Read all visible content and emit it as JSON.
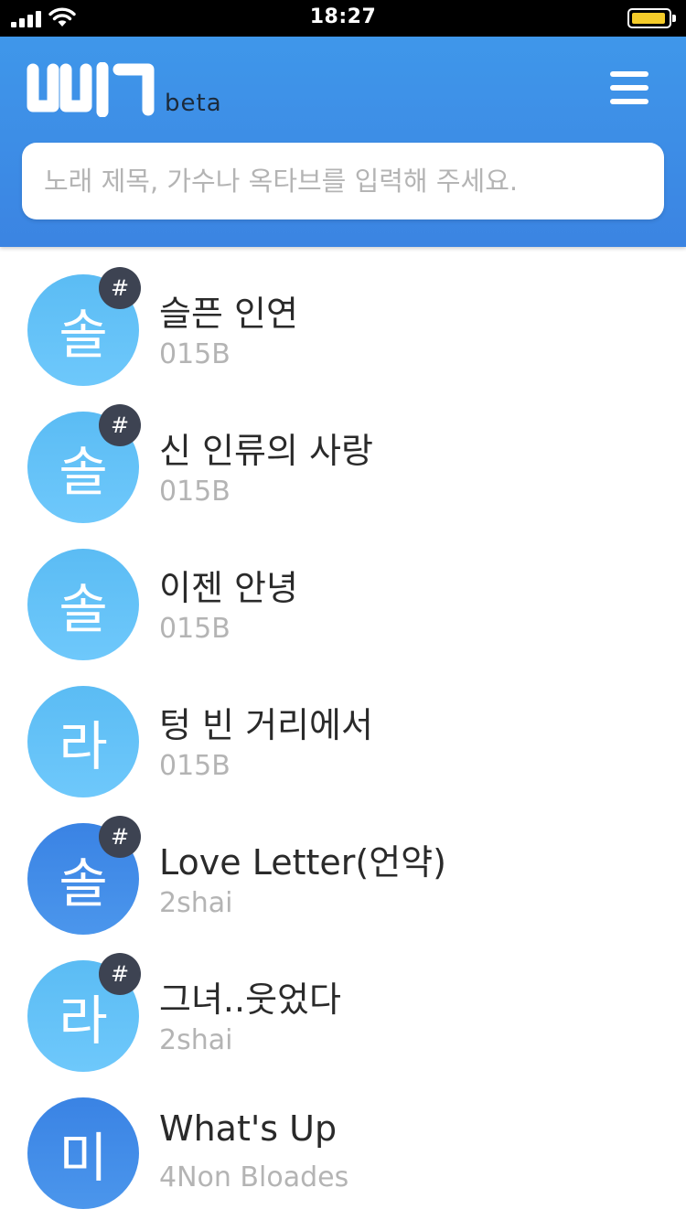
{
  "status_bar": {
    "time": "18:27"
  },
  "header": {
    "logo_text": "삐기",
    "beta_label": "beta",
    "search_placeholder": "노래 제목, 가수나 옥타브를 입력해 주세요."
  },
  "badge_symbol": "#",
  "colors": {
    "header_blue": "#3b8ae5",
    "avatar_light": "#62c1f7",
    "avatar_dark": "#3f8ae6",
    "badge": "#3d4352",
    "battery": "#f5cc2a"
  },
  "songs": [
    {
      "note": "솔",
      "title": "슬픈 인연",
      "artist": "015B",
      "badge": true,
      "tone": "light"
    },
    {
      "note": "솔",
      "title": "신 인류의 사랑",
      "artist": "015B",
      "badge": true,
      "tone": "light"
    },
    {
      "note": "솔",
      "title": "이젠 안녕",
      "artist": "015B",
      "badge": false,
      "tone": "light"
    },
    {
      "note": "라",
      "title": "텅 빈 거리에서",
      "artist": "015B",
      "badge": false,
      "tone": "light"
    },
    {
      "note": "솔",
      "title": "Love Letter(언약)",
      "artist": "2shai",
      "badge": true,
      "tone": "dark"
    },
    {
      "note": "라",
      "title": "그녀..웃었다",
      "artist": "2shai",
      "badge": true,
      "tone": "light"
    },
    {
      "note": "미",
      "title": "What's Up",
      "artist": "4Non Bloades",
      "badge": false,
      "tone": "dark"
    }
  ]
}
